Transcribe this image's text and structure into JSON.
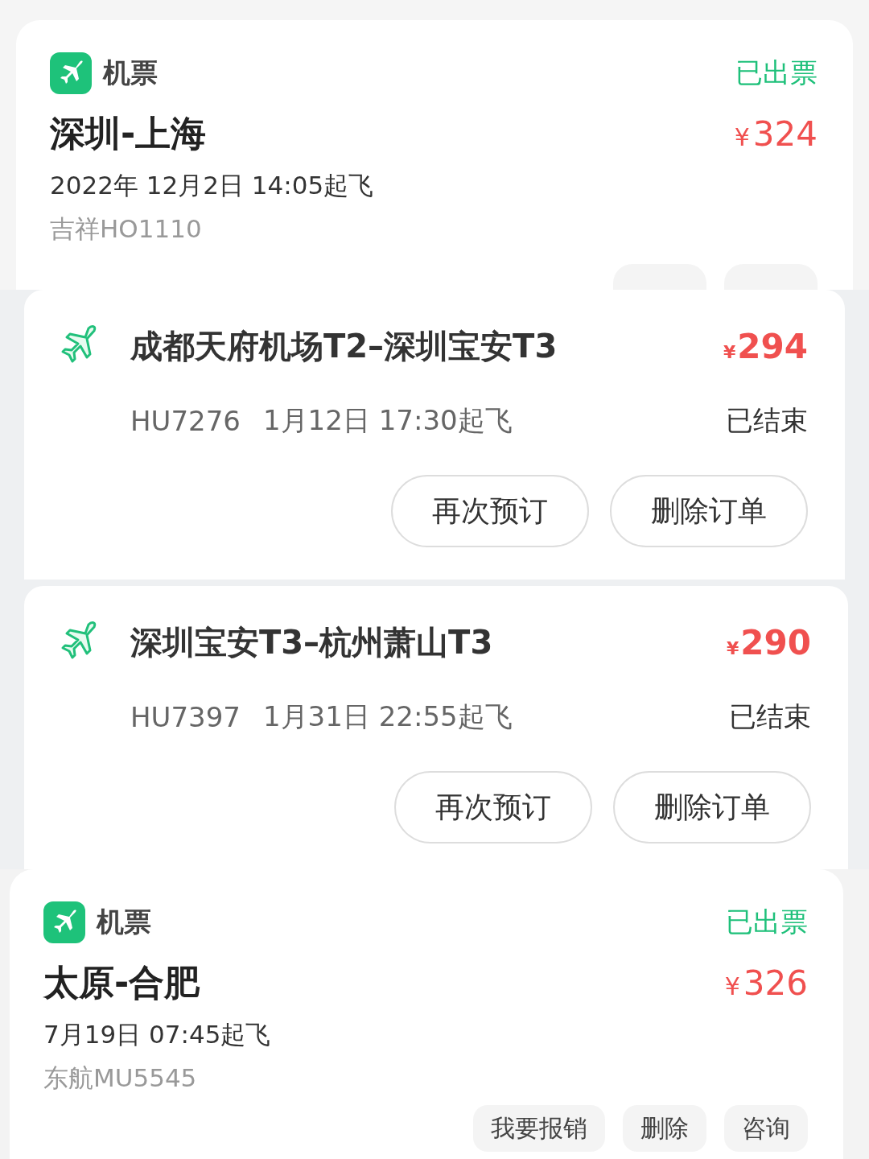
{
  "orders": [
    {
      "kind": "ticket",
      "category": "机票",
      "status": "已出票",
      "route": "深圳-上海",
      "currency": "¥",
      "price": "324",
      "departure": "2022年 12月2日 14:05起飞",
      "flight": "吉祥HO1110"
    },
    {
      "kind": "trip",
      "route": "成都天府机场T2–深圳宝安T3",
      "currency": "¥",
      "price": "294",
      "flight": "HU7276",
      "departure": "1月12日 17:30起飞",
      "status": "已结束",
      "buttons": [
        "再次预订",
        "删除订单"
      ]
    },
    {
      "kind": "trip",
      "route": "深圳宝安T3–杭州萧山T3",
      "currency": "¥",
      "price": "290",
      "flight": "HU7397",
      "departure": "1月31日 22:55起飞",
      "status": "已结束",
      "buttons": [
        "再次预订",
        "删除订单"
      ]
    },
    {
      "kind": "ticket",
      "category": "机票",
      "status": "已出票",
      "route": "太原-合肥",
      "currency": "¥",
      "price": "326",
      "departure": "7月19日 07:45起飞",
      "flight": "东航MU5545",
      "buttons": [
        "我要报销",
        "删除",
        "咨询"
      ]
    }
  ]
}
